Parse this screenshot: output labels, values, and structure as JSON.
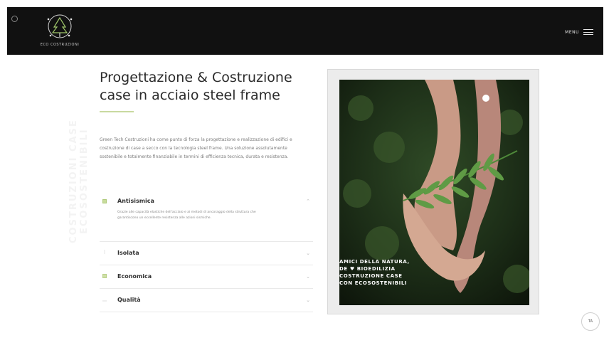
{
  "header": {
    "logo_text": "ECO COSTRUZIONI",
    "menu_label": "MENU"
  },
  "side_watermark": "COSTRUZIONI CASE ECOSOSTENIBILI",
  "hero": {
    "title": "Progettazione & Costruzione case in acciaio steel frame",
    "description": "Green Tech Costruzioni ha come punto di forza la progettazione e realizzazione di edifici e costruzione di case a secco con la tecnologia steel frame. Una soluzione assolutamente sostenibile e totalmente finanziabile in termini di efficienza tecnica, durata e resistenza."
  },
  "features": [
    {
      "label": "Antisismica",
      "body": "Grazie alle capacità elastiche dell'acciaio e ai metodi di ancoraggio della struttura che garantiscono un eccellente resistenza alle azioni sismiche.",
      "icon": "square-icon",
      "expanded": true
    },
    {
      "label": "Isolata",
      "icon": "line-icon",
      "expanded": false
    },
    {
      "label": "Economica",
      "icon": "square-icon",
      "expanded": false
    },
    {
      "label": "Qualità",
      "icon": "dash-icon",
      "expanded": false
    }
  ],
  "image_overlay": {
    "lines": [
      "AMICI DELLA NATURA,",
      "DE ♥ BIOEDILIZIA",
      "COSTRUZIONE CASE",
      "CON ECOSOSTENIBILI"
    ]
  },
  "scroll_button_label": "TA",
  "colors": {
    "header_bg": "#111111",
    "accent": "#b9cf8a",
    "text_dark": "#2b2b2b"
  }
}
